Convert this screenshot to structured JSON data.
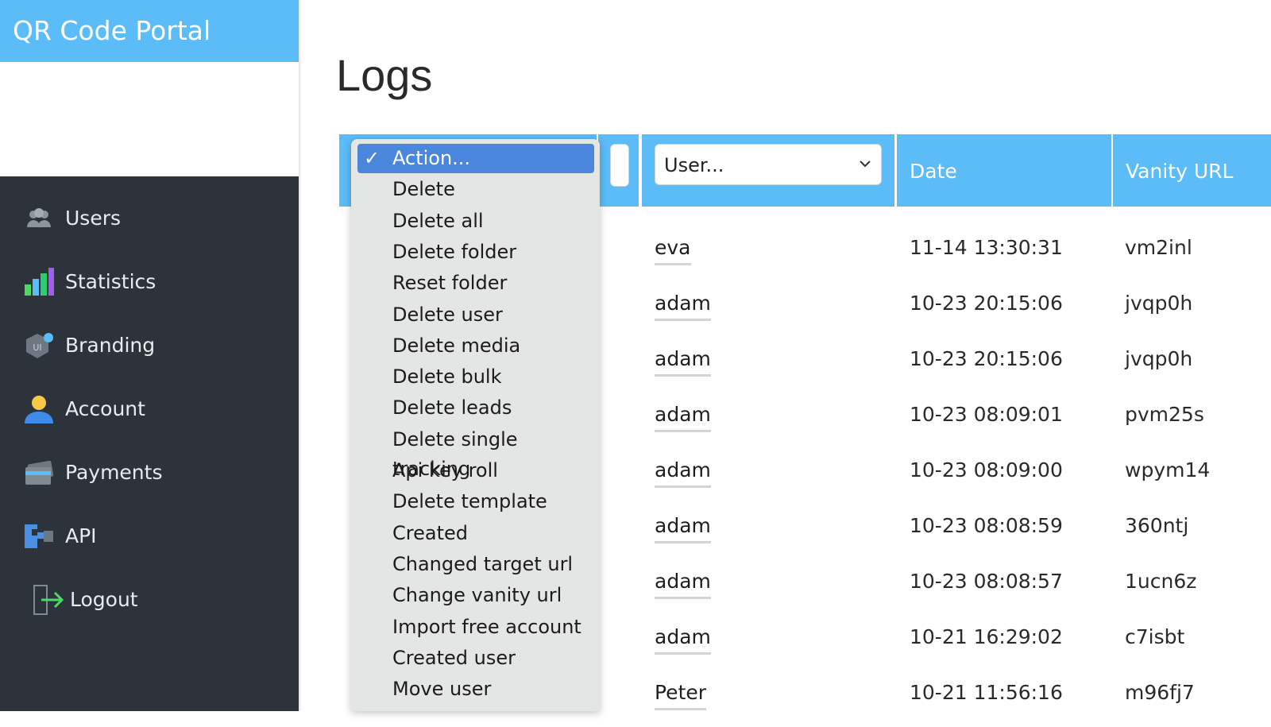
{
  "app": {
    "title": "QR Code Portal"
  },
  "sidebar": {
    "items": [
      {
        "label": "Users",
        "icon": "users-icon"
      },
      {
        "label": "Statistics",
        "icon": "bar-chart-icon"
      },
      {
        "label": "Branding",
        "icon": "branding-icon"
      },
      {
        "label": "Account",
        "icon": "account-icon"
      },
      {
        "label": "Payments",
        "icon": "credit-card-icon"
      },
      {
        "label": "API",
        "icon": "api-icon"
      },
      {
        "label": "Logout",
        "icon": "logout-icon"
      }
    ]
  },
  "page": {
    "title": "Logs"
  },
  "table": {
    "columns": {
      "action_selected": "Action...",
      "user_placeholder": "User...",
      "date": "Date",
      "vanity": "Vanity URL"
    },
    "rows": [
      {
        "user": "eva",
        "date": "11-14 13:30:31",
        "vanity": "vm2inl"
      },
      {
        "user": "adam",
        "date": "10-23 20:15:06",
        "vanity": "jvqp0h"
      },
      {
        "user": "adam",
        "date": "10-23 20:15:06",
        "vanity": "jvqp0h"
      },
      {
        "user": "adam",
        "date": "10-23 08:09:01",
        "vanity": "pvm25s"
      },
      {
        "user": "adam",
        "date": "10-23 08:09:00",
        "vanity": "wpym14"
      },
      {
        "user": "adam",
        "date": "10-23 08:08:59",
        "vanity": "360ntj"
      },
      {
        "user": "adam",
        "date": "10-23 08:08:57",
        "vanity": "1ucn6z"
      },
      {
        "user": "adam",
        "date": "10-21 16:29:02",
        "vanity": "c7isbt"
      },
      {
        "user": "Peter",
        "date": "10-21 11:56:16",
        "vanity": "m96fj7"
      }
    ]
  },
  "action_dropdown": {
    "check_mark": "✓",
    "options": [
      "Action...",
      "Delete",
      "Delete all",
      "Delete folder",
      "Reset folder",
      "Delete user",
      "Delete media",
      "Delete bulk",
      "Delete leads",
      "Delete single tracking",
      "Api key roll",
      "Delete template",
      "Created",
      "Changed target url",
      "Change vanity url",
      "Import free account",
      "Created user",
      "Move user"
    ],
    "selected_index": 0
  },
  "colors": {
    "accent": "#5bbcf7",
    "sidebar_bg": "#2c333b",
    "selected_option": "#4a86dc"
  }
}
